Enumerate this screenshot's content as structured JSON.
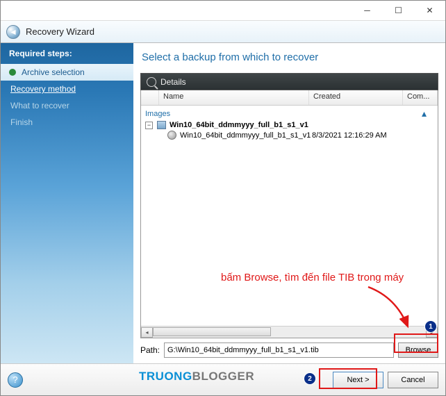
{
  "window": {
    "title": "Recovery Wizard"
  },
  "sidebar": {
    "heading": "Required steps:",
    "steps": [
      {
        "label": "Archive selection"
      },
      {
        "label": "Recovery method"
      },
      {
        "label": "What to recover"
      },
      {
        "label": "Finish"
      }
    ]
  },
  "main": {
    "title": "Select a backup from which to recover",
    "details_label": "Details",
    "columns": {
      "name": "Name",
      "created": "Created",
      "comments": "Com..."
    },
    "category": "Images",
    "tree": {
      "parent": "Win10_64bit_ddmmyyy_full_b1_s1_v1",
      "child": {
        "name": "Win10_64bit_ddmmyyy_full_b1_s1_v1",
        "created": "8/3/2021 12:16:29 AM"
      }
    },
    "path_label": "Path:",
    "path_value": "G:\\Win10_64bit_ddmmyyy_full_b1_s1_v1.tib",
    "browse_label": "Browse"
  },
  "footer": {
    "next": "Next >",
    "cancel": "Cancel"
  },
  "annotations": {
    "hint": "bấm Browse, tìm đến file TIB trong máy",
    "badge1": "1",
    "badge2": "2"
  },
  "watermark": {
    "part1": "TRUONG",
    "part2": "BLOGGER"
  }
}
